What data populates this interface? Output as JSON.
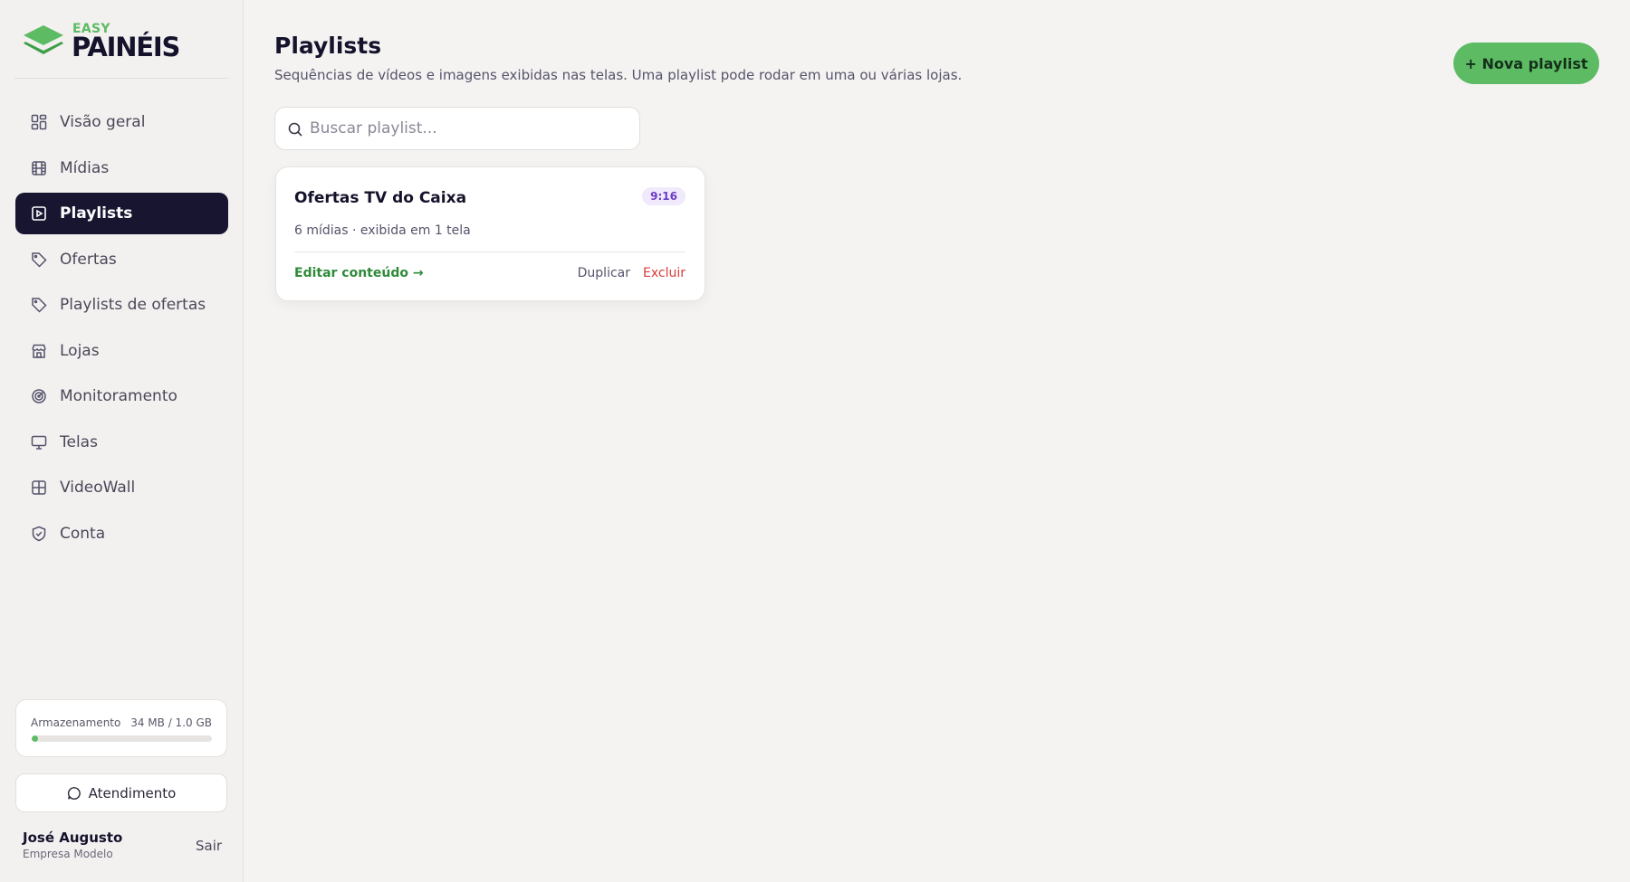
{
  "app": {
    "logo_top": "EASY",
    "logo_main": "PAINÉIS"
  },
  "sidebar": {
    "items": [
      {
        "label": "Visão geral",
        "icon": "grid-icon",
        "active": false
      },
      {
        "label": "Mídias",
        "icon": "film-icon",
        "active": false
      },
      {
        "label": "Playlists",
        "icon": "play-square-icon",
        "active": true
      },
      {
        "label": "Ofertas",
        "icon": "tag-icon",
        "active": false
      },
      {
        "label": "Playlists de ofertas",
        "icon": "tag-icon",
        "active": false
      },
      {
        "label": "Lojas",
        "icon": "store-icon",
        "active": false
      },
      {
        "label": "Monitoramento",
        "icon": "radar-icon",
        "active": false
      },
      {
        "label": "Telas",
        "icon": "monitor-icon",
        "active": false
      },
      {
        "label": "VideoWall",
        "icon": "grid-2x2-icon",
        "active": false
      },
      {
        "label": "Conta",
        "icon": "shield-icon",
        "active": false
      }
    ],
    "storage": {
      "label": "Armazenamento",
      "value": "34 MB / 1.0 GB",
      "fraction": 0.033
    },
    "support_label": "Atendimento",
    "user": {
      "name": "José Augusto",
      "org": "Empresa Modelo",
      "logout_label": "Sair"
    }
  },
  "main": {
    "title": "Playlists",
    "subtitle": "Sequências de vídeos e imagens exibidas nas telas. Uma playlist pode rodar em uma ou várias lojas.",
    "new_button": "+ Nova playlist",
    "search_placeholder": "Buscar playlist...",
    "playlists": [
      {
        "name": "Ofertas TV do Caixa",
        "badge": "9:16",
        "meta": "6 mídias · exibida em 1 tela",
        "edit_label": "Editar conteúdo →",
        "duplicate_label": "Duplicar",
        "delete_label": "Excluir"
      }
    ]
  },
  "colors": {
    "accent_green": "#5dbb63",
    "sidebar_active": "#171530",
    "danger": "#d93a3a",
    "badge_purple": "#6b3cc9"
  }
}
